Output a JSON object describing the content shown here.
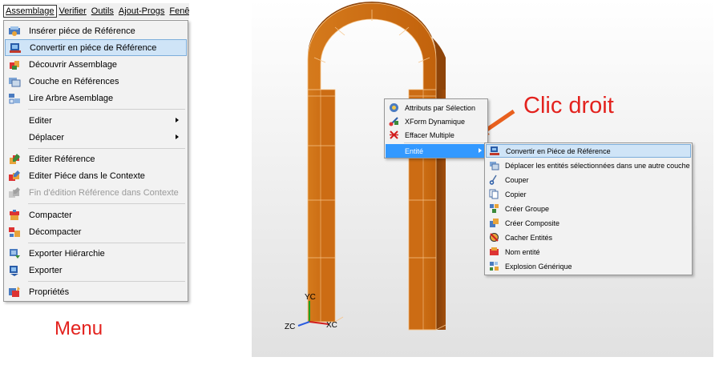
{
  "menubar": {
    "items": [
      {
        "label": "Assemblage"
      },
      {
        "label": "Verifier"
      },
      {
        "label": "Outils"
      },
      {
        "label": "Ajout-Progs"
      },
      {
        "label": "Fenêtre"
      }
    ]
  },
  "assemblage_menu": {
    "items": [
      {
        "label": "Insérer piéce de Référence",
        "icon": "insert-part-icon"
      },
      {
        "label": "Convertir en piéce de Référence",
        "icon": "convert-reference-icon",
        "highlighted": true
      },
      {
        "label": "Découvrir Assemblage",
        "icon": "discover-assembly-icon"
      },
      {
        "label": "Couche en Références",
        "icon": "layer-references-icon"
      },
      {
        "label": "Lire Arbre Asemblage",
        "icon": "read-tree-icon"
      },
      {
        "label": "Editer",
        "submenu": true
      },
      {
        "label": "Déplacer",
        "submenu": true
      },
      {
        "label": "Editer Référence",
        "icon": "edit-reference-icon"
      },
      {
        "label": "Editer Piéce dans le Contexte",
        "icon": "edit-in-context-icon"
      },
      {
        "label": "Fin d'édition Référence dans Contexte",
        "icon": "end-edit-icon",
        "disabled": true
      },
      {
        "label": "Compacter",
        "icon": "compact-icon"
      },
      {
        "label": "Décompacter",
        "icon": "decompact-icon"
      },
      {
        "label": "Exporter Hiérarchie",
        "icon": "export-hierarchy-icon"
      },
      {
        "label": "Exporter",
        "icon": "export-icon"
      },
      {
        "label": "Propriétés",
        "icon": "properties-icon"
      }
    ]
  },
  "captions": {
    "menu": "Menu",
    "clic_droit": "Clic droit"
  },
  "context_menu": {
    "items": [
      {
        "label": "Attributs par Sélection",
        "icon": "attributes-icon"
      },
      {
        "label": "XForm Dynamique",
        "icon": "xform-icon"
      },
      {
        "label": "Effacer Multiple",
        "icon": "erase-multiple-icon"
      },
      {
        "label": "Entité",
        "submenu": true,
        "selected": true
      }
    ]
  },
  "entite_submenu": {
    "items": [
      {
        "label": "Convertir en Piéce de Référence",
        "icon": "convert-reference-icon",
        "highlighted": true
      },
      {
        "label": "Déplacer les entités sélectionnées dans une autre couche",
        "icon": "move-layer-icon"
      },
      {
        "label": "Couper",
        "icon": "cut-icon"
      },
      {
        "label": "Copier",
        "icon": "copy-icon"
      },
      {
        "label": "Créer Groupe",
        "icon": "create-group-icon"
      },
      {
        "label": "Créer Composite",
        "icon": "create-composite-icon"
      },
      {
        "label": "Cacher Entités",
        "icon": "hide-entities-icon"
      },
      {
        "label": "Nom entité",
        "icon": "entity-name-icon"
      },
      {
        "label": "Explosion Générique",
        "icon": "explode-icon"
      }
    ]
  },
  "axes": {
    "y": "YC",
    "z": "ZC",
    "x": "XC"
  },
  "colors": {
    "accent_red": "#e3221e",
    "model_orange": "#c8650e",
    "highlight_blue": "#cfe4f7",
    "selected_blue": "#3399ff"
  }
}
